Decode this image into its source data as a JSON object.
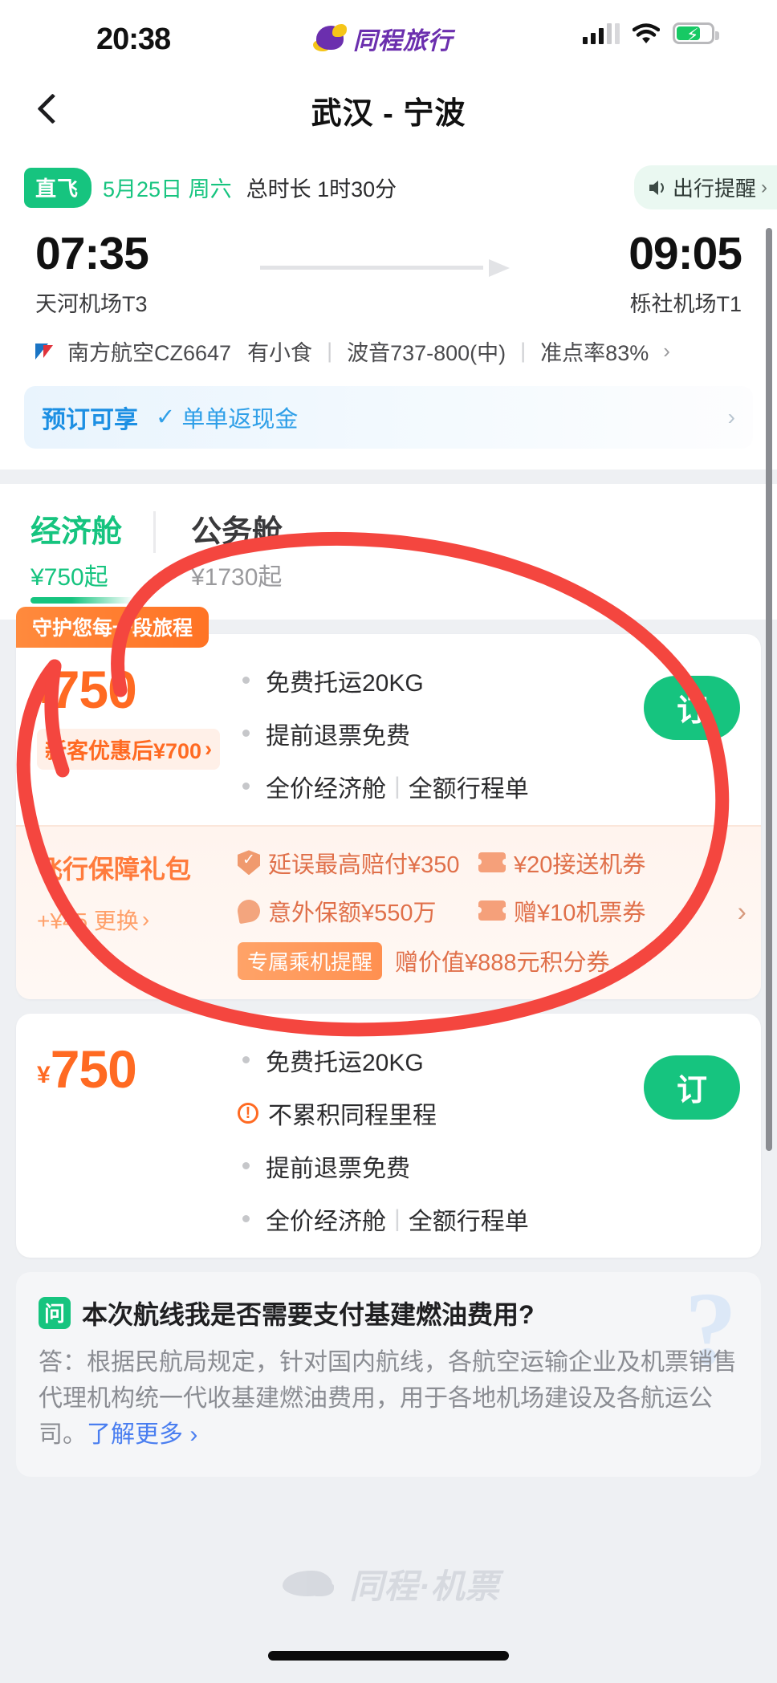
{
  "statusbar": {
    "time": "20:38",
    "brand": "同程旅行",
    "signal_icon": "cellular-bars-icon",
    "wifi_icon": "wifi-icon",
    "battery_icon": "battery-charging-icon"
  },
  "navbar": {
    "back_icon": "chevron-left-icon",
    "title": "武汉 - 宁波"
  },
  "flight": {
    "tag": "直飞",
    "date": "5月25日 周六",
    "duration": "总时长 1时30分",
    "reminder_label": "出行提醒",
    "reminder_icon": "speaker-icon",
    "reminder_chevron": "›",
    "depart_time": "07:35",
    "depart_airport": "天河机场T3",
    "arrive_time": "09:05",
    "arrive_airport": "栎社机场T1",
    "airline": "南方航空CZ6647",
    "meal": "有小食",
    "aircraft": "波音737-800(中)",
    "ontime": "准点率83%",
    "detail_chevron": "›",
    "promo_title": "预订可享",
    "promo_check": "✓",
    "promo_text": "单单返现金",
    "promo_chevron": "›"
  },
  "cabins": [
    {
      "name": "经济舱",
      "price": "¥750起",
      "active": true
    },
    {
      "name": "公务舱",
      "price": "¥1730起",
      "active": false
    }
  ],
  "fares": [
    {
      "ribbon": "守护您每一段旅程",
      "yen": "¥",
      "price": "750",
      "promo": "新客优惠后¥700",
      "promo_chevron": "›",
      "features": [
        {
          "icon": "bullet-dot",
          "text": "免费托运20KG"
        },
        {
          "icon": "bullet-dot",
          "text": "提前退票免费"
        },
        {
          "icon": "bullet-dot",
          "text": "全价经济舱",
          "text2": "全额行程单"
        }
      ],
      "book_label": "订",
      "insurance": {
        "title": "飞行保障礼包",
        "swap": "+¥45 更换",
        "swap_chevron": "›",
        "items": [
          {
            "icon": "shield-icon",
            "text": "延误最高赔付¥350"
          },
          {
            "icon": "ticket-icon",
            "text": "¥20接送机券"
          },
          {
            "icon": "drop-icon",
            "text": "意外保额¥550万"
          },
          {
            "icon": "ticket-icon",
            "text": "赠¥10机票券"
          }
        ],
        "chip": "专属乘机提醒",
        "chip_text": "赠价值¥888元积分券",
        "chevron": "›"
      }
    },
    {
      "yen": "¥",
      "price": "750",
      "features": [
        {
          "icon": "bullet-dot",
          "text": "免费托运20KG"
        },
        {
          "icon": "warning-icon",
          "text": "不累积同程里程"
        },
        {
          "icon": "bullet-dot",
          "text": "提前退票免费"
        },
        {
          "icon": "bullet-dot",
          "text": "全价经济舱",
          "text2": "全额行程单"
        }
      ],
      "book_label": "订"
    }
  ],
  "faq": {
    "badge": "问",
    "question": "本次航线我是否需要支付基建燃油费用?",
    "answer": "答：根据民航局规定，针对国内航线，各航空运输企业及机票销售代理机构统一代收基建燃油费用，用于各地机场建设及各航运公司。",
    "more": "了解更多 ›",
    "watermark_qmark": "?"
  },
  "footer": {
    "watermark": "同程·机票",
    "watermark_icon": "tongcheng-blimp-icon",
    "home_indicator": "home-indicator"
  },
  "annotation": {
    "type": "red-circle-arrow",
    "color": "#f4463f"
  },
  "colors": {
    "brand_purple": "#6b2fae",
    "green": "#16c47f",
    "orange": "#ff6a22",
    "blue": "#1c8fe3",
    "annotation_red": "#f4463f"
  }
}
